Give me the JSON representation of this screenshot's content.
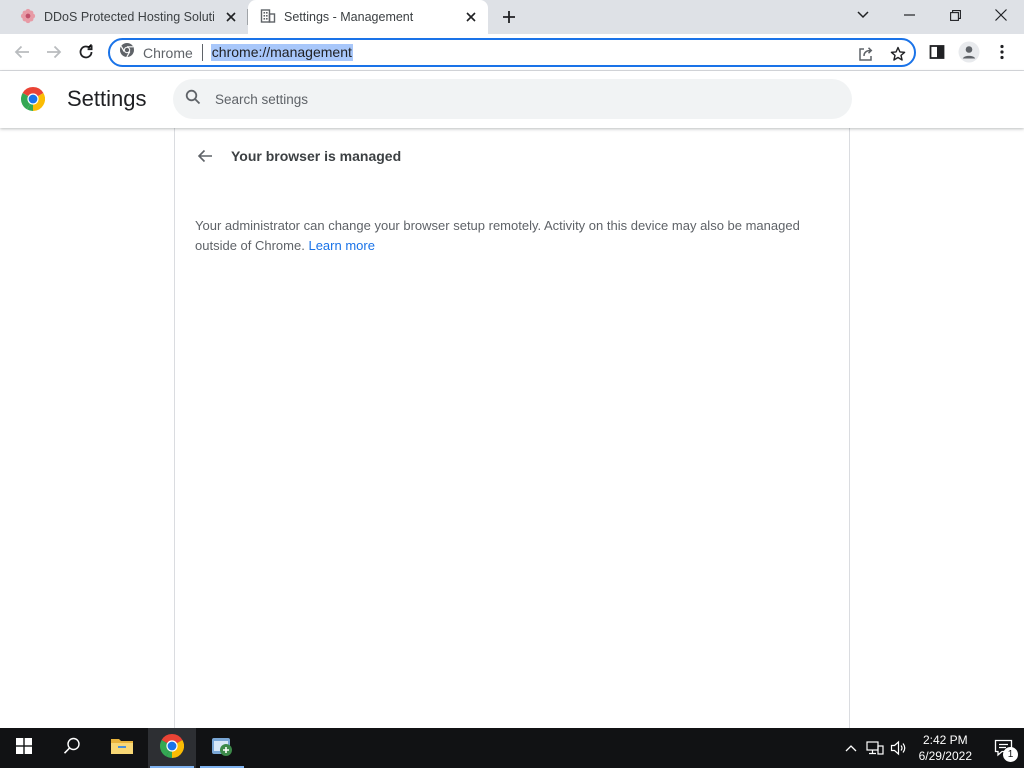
{
  "tabs": [
    {
      "title": "DDoS Protected Hosting Solutions",
      "active": false
    },
    {
      "title": "Settings - Management",
      "active": true
    }
  ],
  "omnibox": {
    "chip": "Chrome",
    "url": "chrome://management"
  },
  "settings": {
    "title": "Settings",
    "search_placeholder": "Search settings"
  },
  "page": {
    "title": "Your browser is managed",
    "description": "Your administrator can change your browser setup remotely. Activity on this device may also be managed outside of Chrome.",
    "learn_more": "Learn more"
  },
  "taskbar": {
    "time": "2:42 PM",
    "date": "6/29/2022",
    "notifications": "1"
  },
  "colors": {
    "accent": "#1a73e8",
    "tabstrip": "#dee1e6",
    "taskbar": "#111214"
  }
}
